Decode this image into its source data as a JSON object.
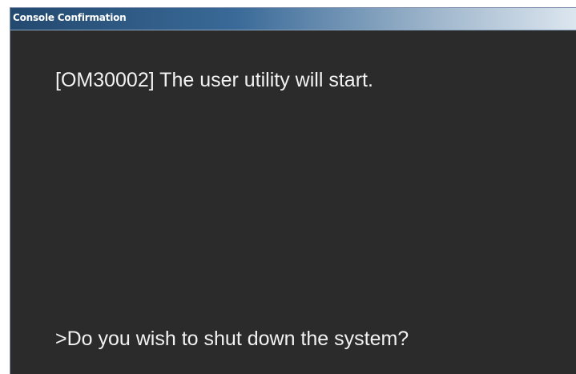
{
  "window": {
    "title": "Console Confirmation"
  },
  "console": {
    "message": "[OM30002] The user utility will start.",
    "prompt": ">Do you wish to shut down the system?"
  },
  "colors": {
    "background": "#2b2b2b",
    "text": "#f2f2f2",
    "titlebar_start": "#23496f",
    "titlebar_end": "#dce6ef"
  }
}
